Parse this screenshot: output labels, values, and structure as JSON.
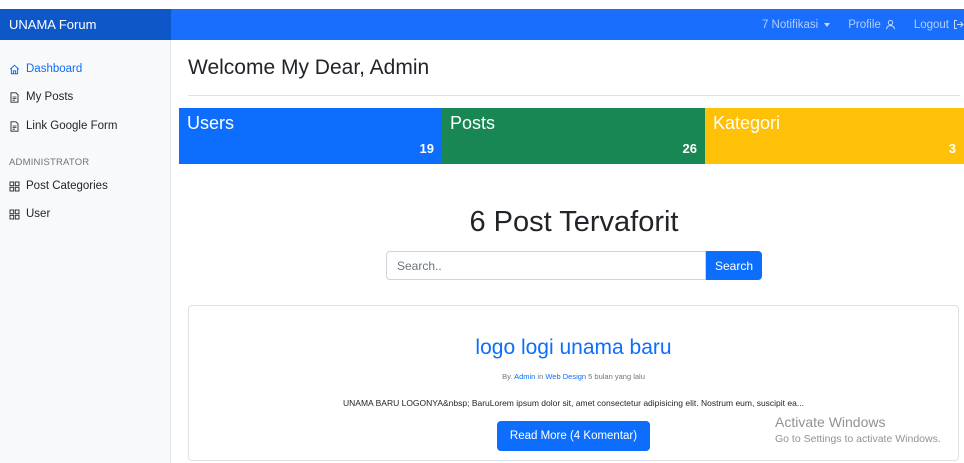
{
  "header": {
    "brand": "UNAMA Forum",
    "notifications_label": "7 Notifikasi",
    "profile_label": "Profile",
    "logout_label": "Logout"
  },
  "sidebar": {
    "items": [
      {
        "label": "Dashboard",
        "icon": "house-icon",
        "active": true
      },
      {
        "label": "My Posts",
        "icon": "file-icon"
      },
      {
        "label": "Link Google Form",
        "icon": "file-icon"
      }
    ],
    "admin_heading": "ADMINISTRATOR",
    "admin_items": [
      {
        "label": "Post Categories",
        "icon": "grid-icon"
      },
      {
        "label": "User",
        "icon": "grid-icon"
      }
    ]
  },
  "main": {
    "title": "Welcome My Dear, Admin",
    "stats": [
      {
        "label": "Users",
        "value": "19",
        "color": "#0d6efd"
      },
      {
        "label": "Posts",
        "value": "26",
        "color": "#198754"
      },
      {
        "label": "Kategori",
        "value": "3",
        "color": "#ffc107"
      }
    ],
    "section_title": "6 Post Tervaforit",
    "search": {
      "placeholder": "Search..",
      "button_label": "Search"
    },
    "post": {
      "title": "logo logi unama baru",
      "meta_by": "By.",
      "meta_author": "Admin",
      "meta_in": "in",
      "meta_category": "Web Design",
      "meta_time": "5 bulan yang lalu",
      "excerpt": "UNAMA BARU LOGONYA&nbsp; BaruLorem ipsum dolor sit, amet consectetur adipisicing elit. Nostrum eum, suscipit ea...",
      "read_more_label": "Read More (4 Komentar)"
    }
  },
  "watermark": {
    "line1": "Activate Windows",
    "line2": "Go to Settings to activate Windows."
  },
  "colors": {
    "brand_blue": "#1a6efd",
    "primary": "#0d6efd",
    "success": "#198754",
    "warning": "#ffc107"
  }
}
